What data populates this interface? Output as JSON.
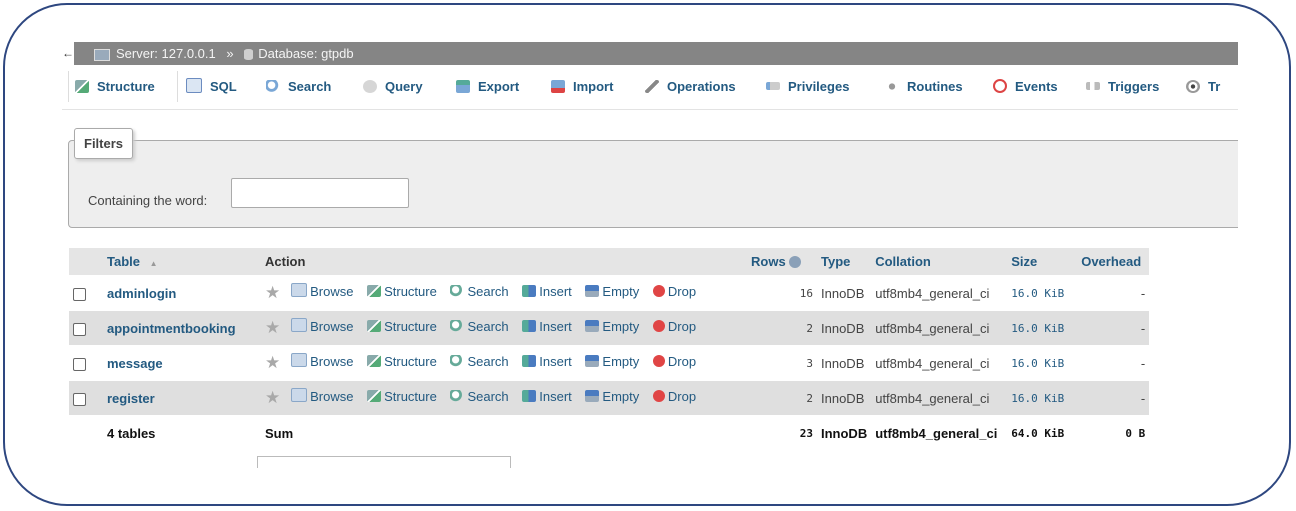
{
  "breadcrumb": {
    "server_label": "Server: 127.0.0.1",
    "separator": "»",
    "database_label": "Database: gtpdb"
  },
  "tabs": [
    {
      "label": "Structure",
      "icon": "structure-icon",
      "active": true
    },
    {
      "label": "SQL",
      "icon": "sql-icon"
    },
    {
      "label": "Search",
      "icon": "search-icon"
    },
    {
      "label": "Query",
      "icon": "query-icon"
    },
    {
      "label": "Export",
      "icon": "export-icon"
    },
    {
      "label": "Import",
      "icon": "import-icon"
    },
    {
      "label": "Operations",
      "icon": "wrench-icon"
    },
    {
      "label": "Privileges",
      "icon": "privileges-icon"
    },
    {
      "label": "Routines",
      "icon": "routines-icon"
    },
    {
      "label": "Events",
      "icon": "clock-icon"
    },
    {
      "label": "Triggers",
      "icon": "triggers-icon"
    },
    {
      "label": "Tr",
      "icon": "eye-icon"
    }
  ],
  "filters": {
    "legend": "Filters",
    "containing_label": "Containing the word:",
    "input_value": ""
  },
  "table": {
    "headers": {
      "table": "Table",
      "sort_indicator": "▲",
      "action": "Action",
      "rows": "Rows",
      "type": "Type",
      "collation": "Collation",
      "size": "Size",
      "overhead": "Overhead"
    },
    "actions": [
      "Browse",
      "Structure",
      "Search",
      "Insert",
      "Empty",
      "Drop"
    ],
    "rows": [
      {
        "name": "adminlogin",
        "rows": "16",
        "type": "InnoDB",
        "collation": "utf8mb4_general_ci",
        "size": "16.0 KiB",
        "overhead": "-"
      },
      {
        "name": "appointmentbooking",
        "rows": "2",
        "type": "InnoDB",
        "collation": "utf8mb4_general_ci",
        "size": "16.0 KiB",
        "overhead": "-"
      },
      {
        "name": "message",
        "rows": "3",
        "type": "InnoDB",
        "collation": "utf8mb4_general_ci",
        "size": "16.0 KiB",
        "overhead": "-"
      },
      {
        "name": "register",
        "rows": "2",
        "type": "InnoDB",
        "collation": "utf8mb4_general_ci",
        "size": "16.0 KiB",
        "overhead": "-"
      }
    ],
    "footer": {
      "count": "4 tables",
      "sum_label": "Sum",
      "rows": "23",
      "type": "InnoDB",
      "collation": "utf8mb4_general_ci",
      "size": "64.0 KiB",
      "overhead": "0 B"
    }
  },
  "colors": {
    "frame_border": "#2e4780",
    "topbar_bg": "#858585",
    "link": "#235a81",
    "row_alt": "#dfdfdf"
  }
}
